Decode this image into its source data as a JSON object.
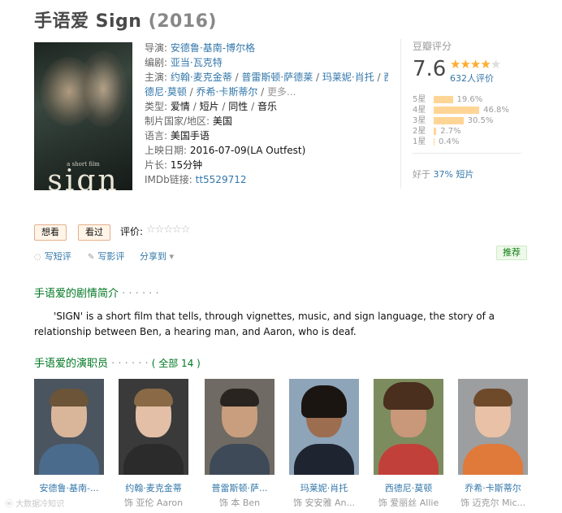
{
  "header": {
    "title": "手语爱 Sign",
    "year": "(2016)"
  },
  "poster": {
    "tagline": "a short film",
    "word": "sign"
  },
  "info": {
    "director_label": "导演:",
    "director": "安德鲁·基南-博尔格",
    "writer_label": "编剧:",
    "writer": "亚当·瓦克特",
    "cast_label": "主演:",
    "cast_line1": [
      "约翰·麦克金蒂",
      "普雷斯顿·萨德莱",
      "玛莱妮·肖托"
    ],
    "cast_line1_tail": "西",
    "cast_line2": [
      "德尼·莫顿",
      "乔希·卡斯蒂尔"
    ],
    "more": "更多...",
    "genre_label": "类型:",
    "genres": [
      "爱情",
      "短片",
      "同性",
      "音乐"
    ],
    "country_label": "制片国家/地区:",
    "country": "美国",
    "language_label": "语言:",
    "language": "美国手语",
    "release_label": "上映日期:",
    "release": "2016-07-09(LA Outfest)",
    "runtime_label": "片长:",
    "runtime": "15分钟",
    "imdb_label": "IMDb链接:",
    "imdb": "tt5529712"
  },
  "rating": {
    "header": "豆瓣评分",
    "score": "7.6",
    "stars_filled": 4,
    "count": "632人评价",
    "distribution": [
      {
        "label": "5星",
        "percent": "19.6%",
        "value": 19.6
      },
      {
        "label": "4星",
        "percent": "46.8%",
        "value": 46.8
      },
      {
        "label": "3星",
        "percent": "30.5%",
        "value": 30.5
      },
      {
        "label": "2星",
        "percent": "2.7%",
        "value": 2.7
      },
      {
        "label": "1星",
        "percent": "0.4%",
        "value": 0.4
      }
    ],
    "better_prefix": "好于",
    "better_pct": "37%",
    "better_suffix": "短片"
  },
  "actions": {
    "want": "想看",
    "seen": "看过",
    "rate_label": "评价:",
    "short_review": "写短评",
    "review": "写影评",
    "share": "分享到",
    "share_caret": "▾",
    "recommend": "推荐"
  },
  "synopsis": {
    "title": "手语爱的剧情简介",
    "dots": " · · · · · ·",
    "text": "'SIGN' is a short film that tells, through vignettes, music, and sign language, the story of a relationship between Ben, a hearing man, and Aaron, who is deaf."
  },
  "cast_section": {
    "title": "手语爱的演职员",
    "dots": " · · · · · ·",
    "all": "( 全部 14 )",
    "members": [
      {
        "name": "安德鲁·基南-...",
        "role": ""
      },
      {
        "name": "约翰·麦克金蒂",
        "role": "饰 亚伦 Aaron"
      },
      {
        "name": "普雷斯顿·萨...",
        "role": "饰 本 Ben"
      },
      {
        "name": "玛莱妮·肖托",
        "role": "饰 安安雅 An..."
      },
      {
        "name": "西德尼·莫顿",
        "role": "饰 爱丽丝 Allie"
      },
      {
        "name": "乔希·卡斯蒂尔",
        "role": "饰 迈克尔 Mic..."
      }
    ]
  },
  "watermark": "大数据冷知识"
}
